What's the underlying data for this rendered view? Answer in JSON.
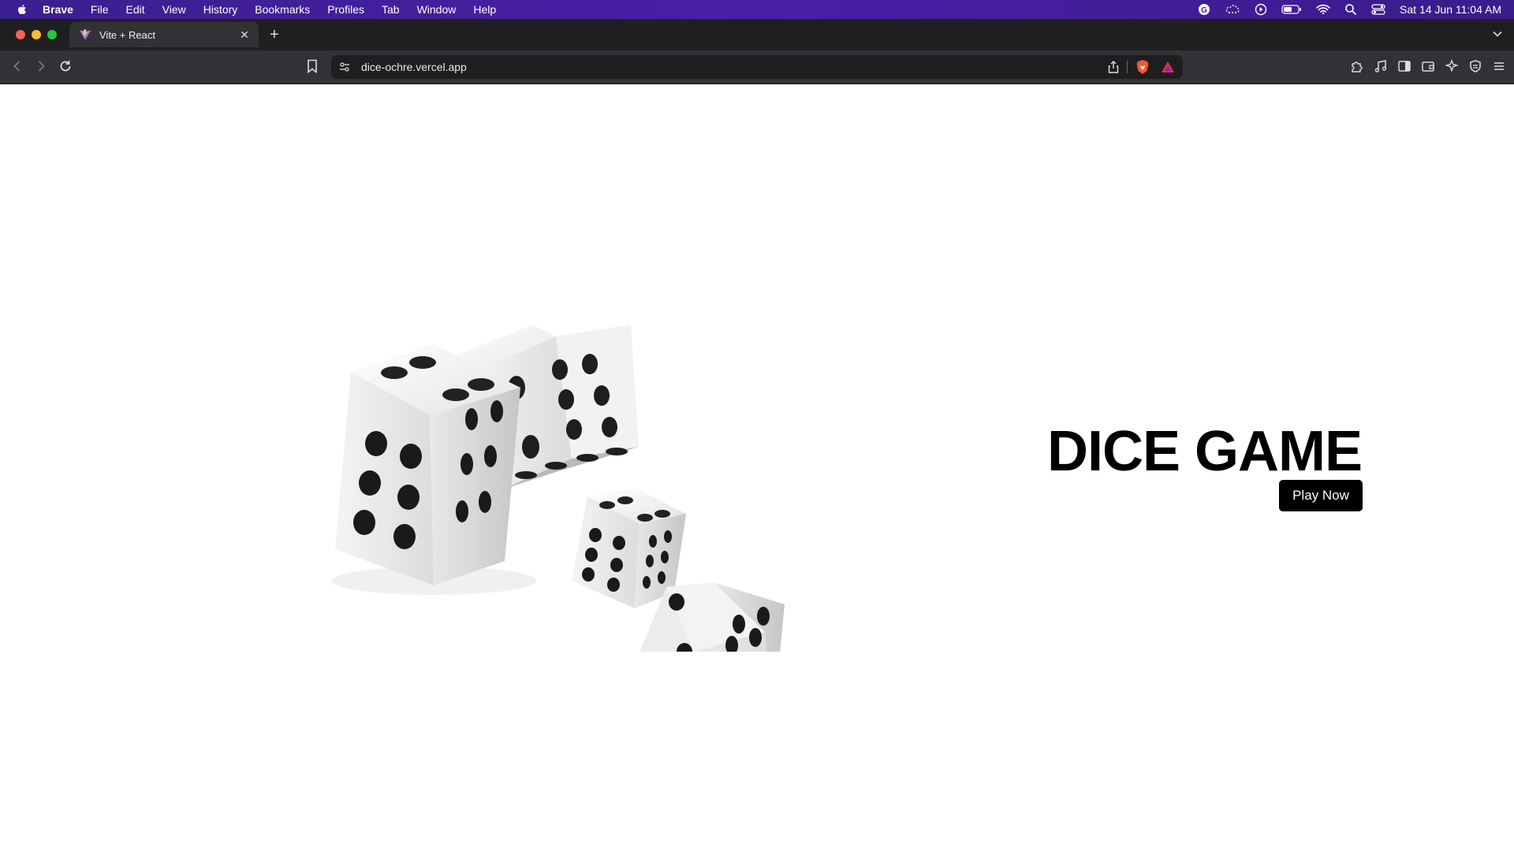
{
  "menubar": {
    "app_name": "Brave",
    "items": [
      "File",
      "Edit",
      "View",
      "History",
      "Bookmarks",
      "Profiles",
      "Tab",
      "Window",
      "Help"
    ],
    "clock": "Sat 14 Jun  11:04 AM",
    "status_icons": [
      "grammarly-icon",
      "cloud-sync-icon",
      "play-icon",
      "battery-icon",
      "wifi-icon",
      "spotlight-search-icon",
      "control-center-icon"
    ]
  },
  "browser": {
    "tab": {
      "title": "Vite + React",
      "favicon": "vite-icon"
    },
    "url": "dice-ochre.vercel.app",
    "colors": {
      "chrome_dark": "#1f1f22",
      "toolbar": "#323236",
      "menubar": "#4a1fa8"
    }
  },
  "page": {
    "title": "DICE GAME",
    "play_button_label": "Play Now",
    "image": "dice-illustration"
  }
}
